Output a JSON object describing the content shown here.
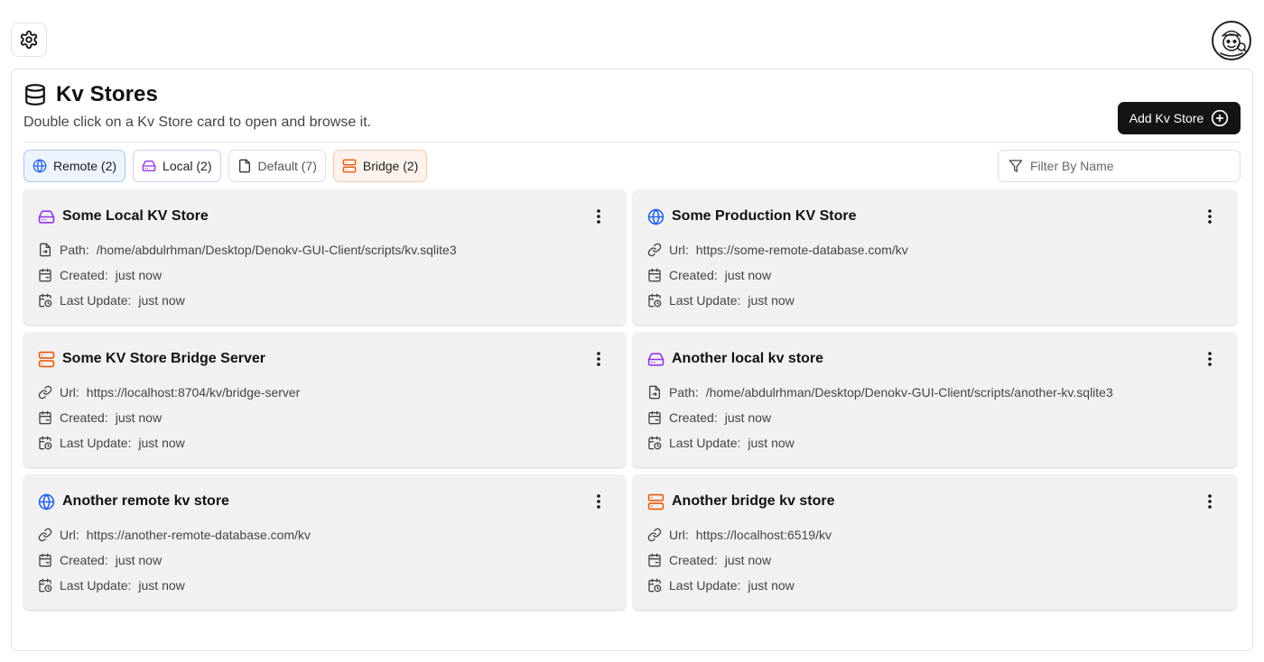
{
  "header": {
    "settings_icon": "gear-icon",
    "avatar_icon": "avatar-illustration"
  },
  "panel": {
    "title": "Kv Stores",
    "title_icon": "database-icon",
    "subtitle": "Double click on a Kv Store card to open and browse it.",
    "add_button_label": "Add Kv Store",
    "add_button_icon": "plus-circle-icon"
  },
  "filters": [
    {
      "label": "Remote (2)",
      "icon": "globe-icon",
      "color": "#2563eb"
    },
    {
      "label": "Local (2)",
      "icon": "hard-drive-icon",
      "color": "#9333ea"
    },
    {
      "label": "Default (7)",
      "icon": "file-icon",
      "color": "#333333"
    },
    {
      "label": "Bridge (2)",
      "icon": "server-icon",
      "color": "#ea580c"
    }
  ],
  "search": {
    "placeholder": "Filter By Name",
    "value": "",
    "icon": "funnel-icon"
  },
  "cards": [
    {
      "type": "local",
      "title": "Some Local KV Store",
      "location_label": "Path:",
      "location": "/home/abdulrhman/Desktop/Denokv-GUI-Client/scripts/kv.sqlite3",
      "created_label": "Created:",
      "created": "just now",
      "updated_label": "Last Update:",
      "updated": "just now"
    },
    {
      "type": "remote",
      "title": "Some Production KV Store",
      "location_label": "Url:",
      "location": "https://some-remote-database.com/kv",
      "created_label": "Created:",
      "created": "just now",
      "updated_label": "Last Update:",
      "updated": "just now"
    },
    {
      "type": "bridge",
      "title": "Some KV Store Bridge Server",
      "location_label": "Url:",
      "location": "https://localhost:8704/kv/bridge-server",
      "created_label": "Created:",
      "created": "just now",
      "updated_label": "Last Update:",
      "updated": "just now"
    },
    {
      "type": "local",
      "title": "Another local kv store",
      "location_label": "Path:",
      "location": "/home/abdulrhman/Desktop/Denokv-GUI-Client/scripts/another-kv.sqlite3",
      "created_label": "Created:",
      "created": "just now",
      "updated_label": "Last Update:",
      "updated": "just now"
    },
    {
      "type": "remote",
      "title": "Another remote kv store",
      "location_label": "Url:",
      "location": "https://another-remote-database.com/kv",
      "created_label": "Created:",
      "created": "just now",
      "updated_label": "Last Update:",
      "updated": "just now"
    },
    {
      "type": "bridge",
      "title": "Another bridge kv store",
      "location_label": "Url:",
      "location": "https://localhost:6519/kv",
      "created_label": "Created:",
      "created": "just now",
      "updated_label": "Last Update:",
      "updated": "just now"
    }
  ],
  "colors": {
    "remote": "#2563eb",
    "local": "#9333ea",
    "bridge": "#ea580c",
    "button_bg": "#141414"
  }
}
